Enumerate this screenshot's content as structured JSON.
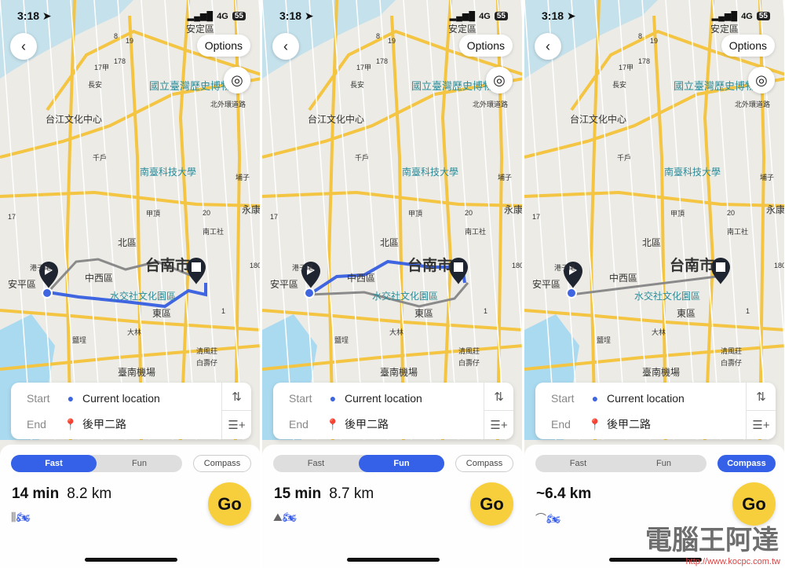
{
  "status": {
    "time": "3:18",
    "network": "4G",
    "battery": "55"
  },
  "map_labels": [
    "安定區",
    "國立臺灣歷史博物館",
    "台江文化中心",
    "南臺科技大學",
    "北區",
    "台南市",
    "中西區",
    "安平區",
    "港子尾",
    "水交社文化園區",
    "東區",
    "臺南機場",
    "長安",
    "千戶",
    "埔子",
    "永康",
    "南工社",
    "甲頂",
    "鹽埕",
    "大林",
    "清風莊",
    "白壽仔",
    "北外環道路",
    "17甲",
    "178",
    "19",
    "8",
    "20",
    "17",
    "180",
    "1"
  ],
  "common": {
    "options_label": "Options",
    "start_label": "Start",
    "end_label": "End",
    "start_value": "Current location",
    "end_value": "後甲二路",
    "go_label": "Go",
    "tabs": [
      "Fast",
      "Fun",
      "Compass"
    ]
  },
  "phones": [
    {
      "active_tab": "Fast",
      "time": "14 min",
      "distance": "8.2 km"
    },
    {
      "active_tab": "Fun",
      "time": "15 min",
      "distance": "8.7 km"
    },
    {
      "active_tab": "Compass",
      "time": "",
      "distance": "~6.4 km"
    }
  ],
  "watermark": {
    "text": "電腦王阿達",
    "url": "http://www.kocpc.com.tw"
  },
  "colors": {
    "route": "#3f66e0",
    "alt_route": "#8a8a8a",
    "accent": "#3461e8",
    "go": "#f7cf3d",
    "road": "#f4c542"
  }
}
